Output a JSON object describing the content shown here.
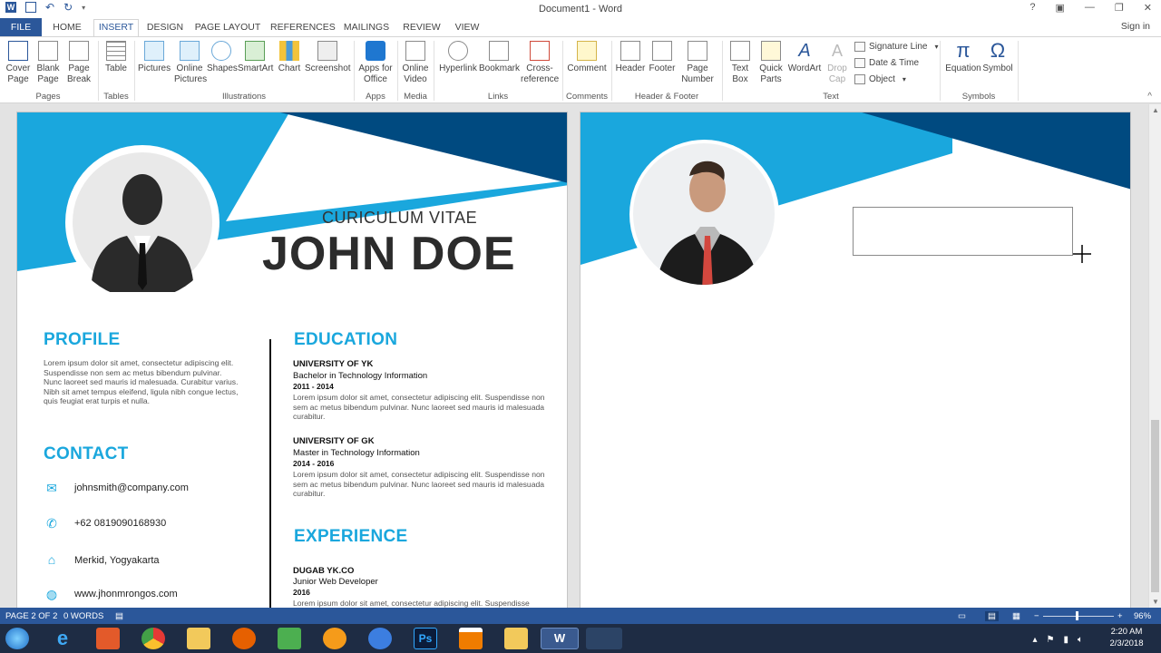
{
  "window": {
    "title": "Document1 - Word",
    "help": "?",
    "signin": "Sign in"
  },
  "tabs": [
    {
      "label": "FILE"
    },
    {
      "label": "HOME"
    },
    {
      "label": "INSERT"
    },
    {
      "label": "DESIGN"
    },
    {
      "label": "PAGE LAYOUT"
    },
    {
      "label": "REFERENCES"
    },
    {
      "label": "MAILINGS"
    },
    {
      "label": "REVIEW"
    },
    {
      "label": "VIEW"
    }
  ],
  "ribbon": {
    "buttons": [
      {
        "label": "Cover Page",
        "l1": "Cover",
        "l2": "Page"
      },
      {
        "label": "Blank Page",
        "l1": "Blank",
        "l2": "Page"
      },
      {
        "label": "Page Break",
        "l1": "Page",
        "l2": "Break"
      },
      {
        "label": "Table",
        "l1": "Table",
        "l2": ""
      },
      {
        "label": "Pictures",
        "l1": "Pictures",
        "l2": ""
      },
      {
        "label": "Online Pictures",
        "l1": "Online",
        "l2": "Pictures"
      },
      {
        "label": "Shapes",
        "l1": "Shapes",
        "l2": ""
      },
      {
        "label": "SmartArt",
        "l1": "SmartArt",
        "l2": ""
      },
      {
        "label": "Chart",
        "l1": "Chart",
        "l2": ""
      },
      {
        "label": "Screenshot",
        "l1": "Screenshot",
        "l2": ""
      },
      {
        "label": "Apps for Office",
        "l1": "Apps for",
        "l2": "Office"
      },
      {
        "label": "Online Video",
        "l1": "Online",
        "l2": "Video"
      },
      {
        "label": "Hyperlink",
        "l1": "Hyperlink",
        "l2": ""
      },
      {
        "label": "Bookmark",
        "l1": "Bookmark",
        "l2": ""
      },
      {
        "label": "Cross-reference",
        "l1": "Cross-",
        "l2": "reference"
      },
      {
        "label": "Comment",
        "l1": "Comment",
        "l2": ""
      },
      {
        "label": "Header",
        "l1": "Header",
        "l2": ""
      },
      {
        "label": "Footer",
        "l1": "Footer",
        "l2": ""
      },
      {
        "label": "Page Number",
        "l1": "Page",
        "l2": "Number"
      },
      {
        "label": "Text Box",
        "l1": "Text",
        "l2": "Box"
      },
      {
        "label": "Quick Parts",
        "l1": "Quick",
        "l2": "Parts"
      },
      {
        "label": "WordArt",
        "l1": "WordArt",
        "l2": ""
      },
      {
        "label": "Drop Cap",
        "l1": "Drop",
        "l2": "Cap"
      },
      {
        "label": "Equation",
        "l1": "Equation",
        "l2": ""
      },
      {
        "label": "Symbol",
        "l1": "Symbol",
        "l2": ""
      }
    ],
    "small": {
      "signature": "Signature Line",
      "datetime": "Date & Time",
      "object": "Object"
    },
    "groups": [
      "Pages",
      "Tables",
      "Illustrations",
      "Apps",
      "Media",
      "Links",
      "Comments",
      "Header & Footer",
      "Text",
      "Symbols"
    ]
  },
  "cv": {
    "subtitle": "CURICULUM VITAE",
    "name": "JOHN DOE",
    "profile_head": "PROFILE",
    "profile_text": "Lorem ipsum dolor sit amet, consectetur adipiscing elit. Suspendisse non sem ac metus bibendum pulvinar. Nunc laoreet sed mauris id malesuada. Curabitur varius. Nibh sit amet tempus eleifend, ligula nibh congue lectus, quis feugiat erat turpis et nulla.",
    "contact_head": "CONTACT",
    "contacts": [
      {
        "icon": "mail-icon",
        "text": "johnsmith@company.com"
      },
      {
        "icon": "phone-icon",
        "text": "+62 0819090168930"
      },
      {
        "icon": "home-icon",
        "text": "Merkid, Yogyakarta"
      },
      {
        "icon": "globe-icon",
        "text": "www.jhonmrongos.com"
      }
    ],
    "education_head": "EDUCATION",
    "education": [
      {
        "school": "UNIVERSITY OF YK",
        "degree": "Bachelor in Technology Information",
        "years": "2011 - 2014",
        "text": "Lorem ipsum dolor sit amet, consectetur adipiscing elit. Suspendisse non sem ac metus bibendum pulvinar. Nunc laoreet sed mauris id malesuada curabitur."
      },
      {
        "school": "UNIVERSITY OF GK",
        "degree": "Master in Technology Information",
        "years": "2014 - 2016",
        "text": "Lorem ipsum dolor sit amet, consectetur adipiscing elit. Suspendisse non sem ac metus bibendum pulvinar. Nunc laoreet sed mauris id malesuada curabitur."
      }
    ],
    "experience_head": "EXPERIENCE",
    "experience": [
      {
        "company": "DUGAB YK.CO",
        "role": "Junior Web Developer",
        "year": "2016",
        "text": "Lorem ipsum dolor sit amet, consectetur adipiscing elit. Suspendisse"
      }
    ]
  },
  "status": {
    "page": "PAGE 2 OF 2",
    "words": "0 WORDS",
    "zoom": "96%"
  },
  "taskbar": {
    "time": "2:20 AM",
    "date": "2/3/2018"
  },
  "colors": {
    "accent": "#1aa7dd",
    "navy": "#004a80",
    "word": "#2b579a"
  }
}
